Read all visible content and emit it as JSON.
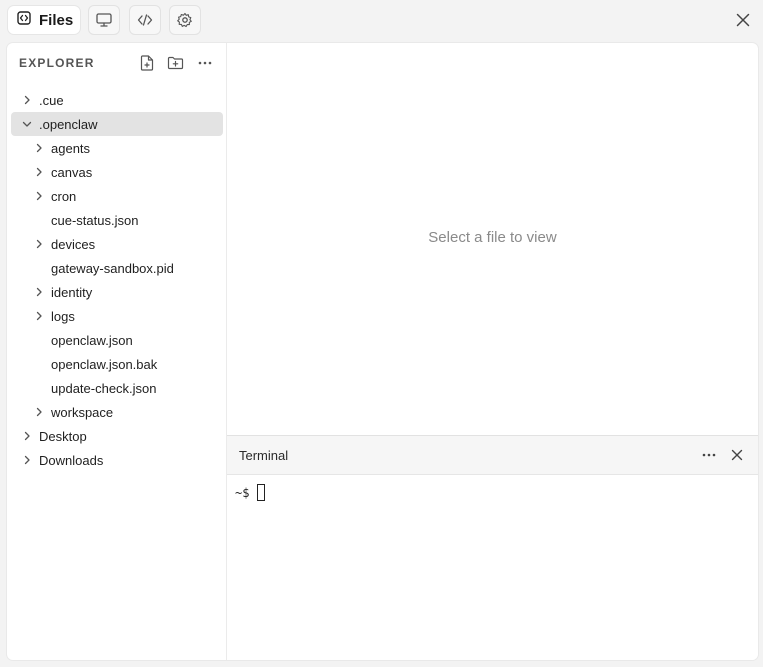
{
  "topbar": {
    "active_tab_label": "Files",
    "icons": [
      "files-icon",
      "monitor-icon",
      "code-icon",
      "gear-icon",
      "close-icon"
    ]
  },
  "explorer": {
    "title": "EXPLORER",
    "actions": [
      "new-file-icon",
      "new-folder-icon",
      "more-icon"
    ],
    "tree": [
      {
        "label": ".cue",
        "type": "folder",
        "level": 0,
        "expanded": false
      },
      {
        "label": ".openclaw",
        "type": "folder",
        "level": 0,
        "expanded": true,
        "selected": true
      },
      {
        "label": "agents",
        "type": "folder",
        "level": 1,
        "expanded": false
      },
      {
        "label": "canvas",
        "type": "folder",
        "level": 1,
        "expanded": false
      },
      {
        "label": "cron",
        "type": "folder",
        "level": 1,
        "expanded": false
      },
      {
        "label": "cue-status.json",
        "type": "file",
        "level": 1
      },
      {
        "label": "devices",
        "type": "folder",
        "level": 1,
        "expanded": false
      },
      {
        "label": "gateway-sandbox.pid",
        "type": "file",
        "level": 1
      },
      {
        "label": "identity",
        "type": "folder",
        "level": 1,
        "expanded": false
      },
      {
        "label": "logs",
        "type": "folder",
        "level": 1,
        "expanded": false
      },
      {
        "label": "openclaw.json",
        "type": "file",
        "level": 1
      },
      {
        "label": "openclaw.json.bak",
        "type": "file",
        "level": 1
      },
      {
        "label": "update-check.json",
        "type": "file",
        "level": 1
      },
      {
        "label": "workspace",
        "type": "folder",
        "level": 1,
        "expanded": false
      },
      {
        "label": "Desktop",
        "type": "folder",
        "level": 0,
        "expanded": false
      },
      {
        "label": "Downloads",
        "type": "folder",
        "level": 0,
        "expanded": false
      }
    ]
  },
  "viewer": {
    "empty_message": "Select a file to view"
  },
  "terminal": {
    "title": "Terminal",
    "prompt": "~$"
  }
}
